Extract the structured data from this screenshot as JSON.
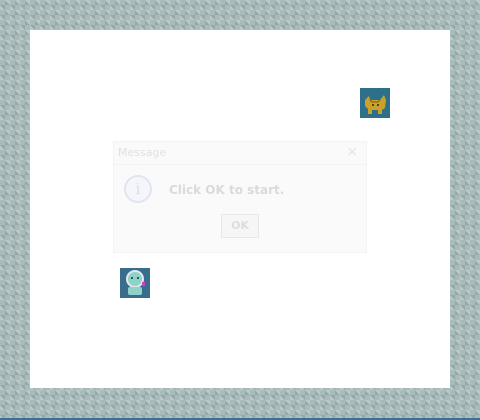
{
  "dialog": {
    "title": "Message",
    "close_glyph": "×",
    "info_glyph": "i",
    "message": "Click OK to start.",
    "ok_label": "OK"
  },
  "sprites": {
    "cat": {
      "icon": "cat-icon"
    },
    "player": {
      "icon": "player-icon"
    }
  },
  "colors": {
    "border_tile": "#a9bcbc",
    "field": "#ffffff",
    "sprite_bg": "#2e6f8a",
    "cat": "#c9a227",
    "player": "#8fd3c8",
    "bottom_line": "#3e6f98"
  }
}
